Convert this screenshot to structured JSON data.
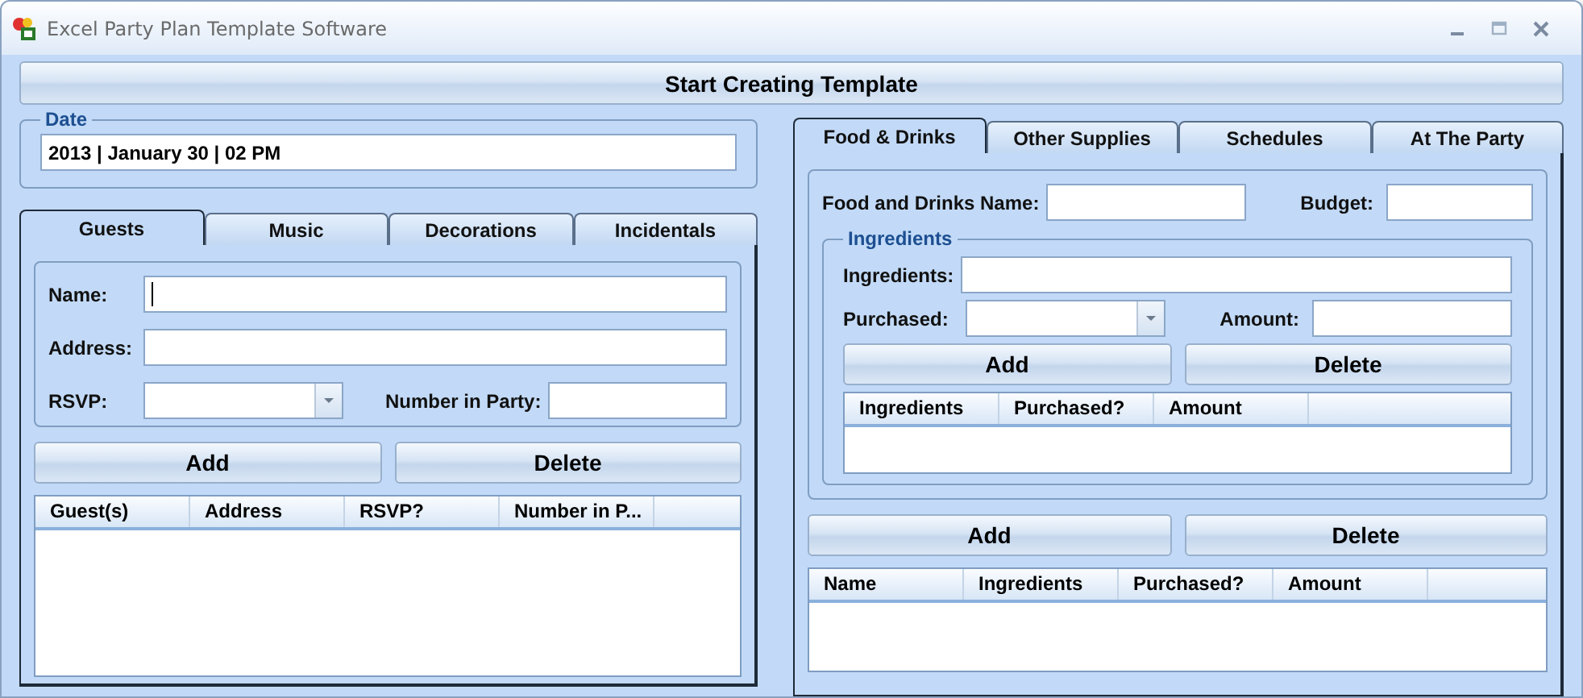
{
  "window": {
    "title": "Excel Party Plan Template Software"
  },
  "start_button": "Start Creating Template",
  "date": {
    "label": "Date",
    "value": "2013 | January 30 | 02 PM"
  },
  "left_tabs": [
    {
      "label": "Guests",
      "selected": true
    },
    {
      "label": "Music",
      "selected": false
    },
    {
      "label": "Decorations",
      "selected": false
    },
    {
      "label": "Incidentals",
      "selected": false
    }
  ],
  "guest_form": {
    "name_label": "Name:",
    "address_label": "Address:",
    "rsvp_label": "RSVP:",
    "number_label": "Number in Party:"
  },
  "guest_buttons": [
    "Add",
    "Delete"
  ],
  "guest_table": {
    "columns": [
      "Guest(s)",
      "Address",
      "RSVP?",
      "Number in P..."
    ]
  },
  "right_tabs": [
    {
      "label": "Food & Drinks",
      "selected": true
    },
    {
      "label": "Other Supplies",
      "selected": false
    },
    {
      "label": "Schedules",
      "selected": false
    },
    {
      "label": "At The Party",
      "selected": false
    }
  ],
  "food_form": {
    "name_label": "Food and Drinks Name:",
    "budget_label": "Budget:"
  },
  "ingredients": {
    "title": "Ingredients",
    "ingredients_label": "Ingredients:",
    "purchased_label": "Purchased:",
    "amount_label": "Amount:",
    "buttons": [
      "Add",
      "Delete"
    ],
    "columns": [
      "Ingredients",
      "Purchased?",
      "Amount"
    ]
  },
  "food_buttons": [
    "Add",
    "Delete"
  ],
  "food_table": {
    "columns": [
      "Name",
      "Ingredients",
      "Purchased?",
      "Amount"
    ]
  }
}
